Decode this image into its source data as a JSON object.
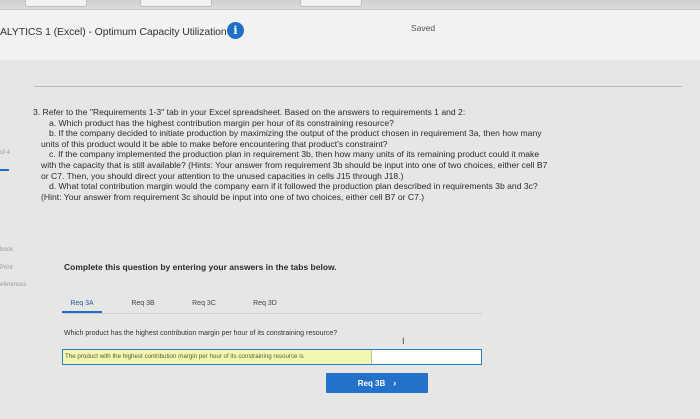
{
  "header": {
    "title": "ALYTICS 1 (Excel) - Optimum Capacity Utilization",
    "info_icon": "info-icon",
    "status": "Saved"
  },
  "left_rail": {
    "progress": "of 4",
    "book": "book",
    "print": "Print",
    "references": "eferences"
  },
  "question": {
    "intro": "3. Refer to the \"Requirements 1-3\" tab in your Excel spreadsheet. Based on the answers to requirements 1 and 2:",
    "a": "a. Which product has the highest contribution margin per hour of its constraining resource?",
    "b": "b. If the company decided to initiate production by maximizing the output of the product chosen in requirement 3a, then how many",
    "b_cont": "units of this product would it be able to make before encountering that product's constraint?",
    "c": "c. If the company implemented the production plan in requirement 3b, then how many units of its remaining product could it make",
    "c_cont1": "with the capacity that is still available? (Hints: Your answer from requirement 3b should be input into one of two choices, either cell B7",
    "c_cont2": "or C7. Then, you should direct your attention to the unused capacities in cells J15 through J18.)",
    "d": "d. What total contribution margin would the company earn if it followed the production plan described in requirements 3b and 3c?",
    "d_cont": "(Hint: Your answer from requirement 3c should be input into one of two choices, either cell B7 or C7.)"
  },
  "instruction": "Complete this question by entering your answers in the tabs below.",
  "tabs": [
    {
      "label": "Req 3A",
      "active": true
    },
    {
      "label": "Req 3B",
      "active": false
    },
    {
      "label": "Req 3C",
      "active": false
    },
    {
      "label": "Req 3D",
      "active": false
    }
  ],
  "req3a": {
    "prompt": "Which product has the highest contribution margin per hour of its constraining resource?",
    "answer_label": "The product with the highest contribution margin per hour of its constraining resource is",
    "answer_value": ""
  },
  "next_button": {
    "label": "Req 3B",
    "chevron": "›"
  },
  "colors": {
    "accent": "#1f6fc9",
    "answer_highlight": "#f3f7b4"
  }
}
